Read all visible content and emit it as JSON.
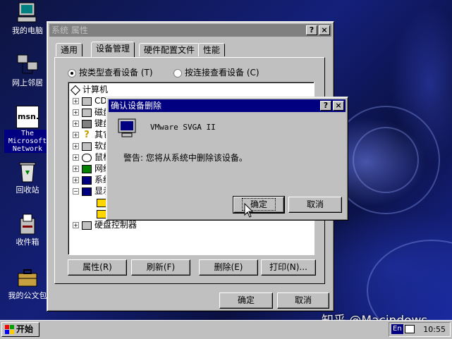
{
  "desktop_icons": [
    {
      "label": "我的电脑",
      "icon": "computer-icon"
    },
    {
      "label": "网上邻居",
      "icon": "network-neighborhood-icon"
    },
    {
      "label": "The Microsoft Network",
      "icon": "msn-icon"
    },
    {
      "label": "回收站",
      "icon": "recycle-bin-icon"
    },
    {
      "label": "收件箱",
      "icon": "inbox-icon"
    },
    {
      "label": "我的公文包",
      "icon": "briefcase-icon"
    }
  ],
  "msn_icon_text": "msn.",
  "system_window": {
    "title": "系统 属性",
    "help_btn": "?",
    "close_btn": "×",
    "tabs": [
      "通用",
      "设备管理",
      "硬件配置文件",
      "性能"
    ],
    "radio_by_type": "按类型查看设备 (T)",
    "radio_by_connection": "按连接查看设备 (C)",
    "tree": [
      {
        "label": "计算机",
        "root": true
      },
      {
        "label": "CDR"
      },
      {
        "label": "磁盘"
      },
      {
        "label": "键盘"
      },
      {
        "label": "其它"
      },
      {
        "label": "软盘"
      },
      {
        "label": "鼠标"
      },
      {
        "label": "网络"
      },
      {
        "label": "系统"
      },
      {
        "label": "显示"
      },
      {
        "label": ""
      },
      {
        "label": ""
      },
      {
        "label": "硬盘控制器"
      }
    ],
    "buttons": {
      "properties": "属性(R)",
      "refresh": "刷新(F)",
      "remove": "删除(E)",
      "print": "打印(N)..."
    },
    "ok": "确定",
    "cancel": "取消"
  },
  "confirm_dialog": {
    "title": "确认设备删除",
    "help_btn": "?",
    "close_btn": "×",
    "device_name": "VMware SVGA II",
    "warning": "警告: 您将从系统中删除该设备。",
    "ok": "确定",
    "cancel": "取消"
  },
  "taskbar": {
    "start_label": "开始",
    "ime_label": "En",
    "clock": "10:55"
  },
  "watermark": "知乎 @Macindows",
  "colors": {
    "title_active": "#000080",
    "title_inactive": "#808080",
    "face": "#c0c0c0"
  }
}
